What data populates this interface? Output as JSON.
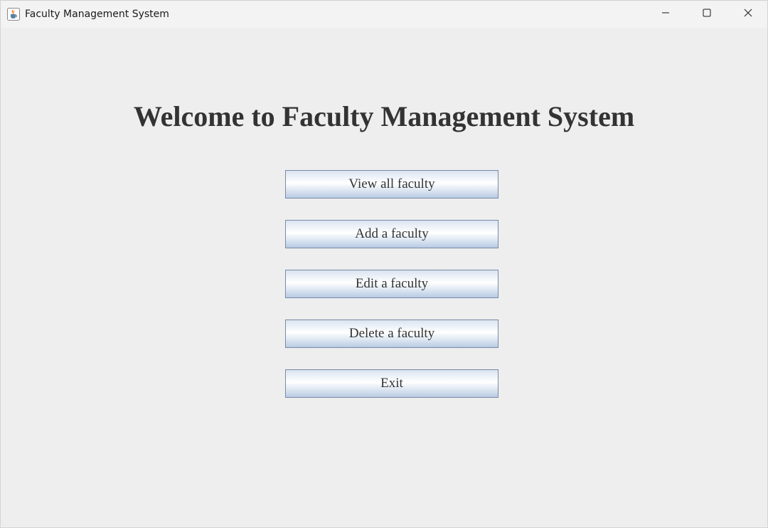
{
  "window": {
    "title": "Faculty Management System",
    "icon": "java-cup-icon",
    "controls": {
      "minimize": "minimize-icon",
      "maximize": "maximize-icon",
      "close": "close-icon"
    }
  },
  "main": {
    "heading": "Welcome to Faculty Management System",
    "buttons": [
      {
        "label": "View all faculty"
      },
      {
        "label": "Add a faculty"
      },
      {
        "label": "Edit a faculty"
      },
      {
        "label": "Delete a faculty"
      },
      {
        "label": "Exit"
      }
    ]
  },
  "colors": {
    "background": "#eeeeee",
    "button_border": "#7a8aa8",
    "text": "#333333"
  }
}
